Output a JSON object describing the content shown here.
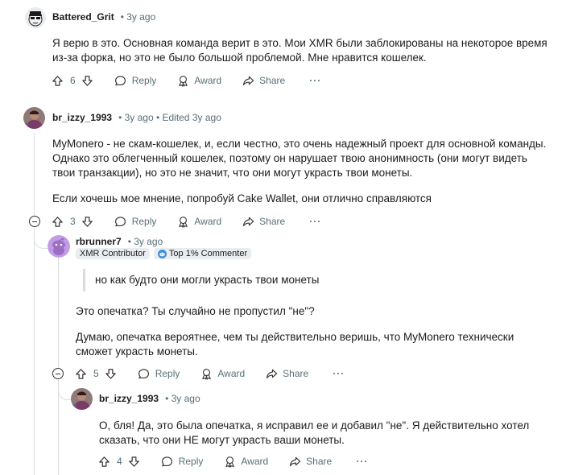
{
  "comments": [
    {
      "username": "Battered_Grit",
      "meta": "• 3y ago",
      "body": [
        "Я верю в это. Основная команда верит в это. Мои XMR были заблокированы на некоторое время из-за форка, но это не было большой проблемой. Мне нравится кошелек."
      ],
      "votes": "6"
    },
    {
      "username": "br_izzy_1993",
      "meta": "• 3y ago • Edited 3y ago",
      "body": [
        "MyMonero - не скам-кошелек, и, если честно, это очень надежный проект для основной команды. Однако это облегченный кошелек, поэтому он нарушает твою анонимность (они могут видеть твои транзакции), но это не значит, что они могут украсть твои монеты.",
        "Если хочешь мое мнение, попробуй Cake Wallet, они отлично справляются"
      ],
      "votes": "3"
    },
    {
      "username": "rbrunner7",
      "meta": "• 3y ago",
      "flair1": "XMR Contributor",
      "flair2": "Top 1% Commenter",
      "quote": "но как будто они могли украсть твои монеты",
      "body": [
        "Это опечатка? Ты случайно не пропустил \"не\"?",
        "Думаю, опечатка вероятнее, чем ты действительно веришь, что MyMonero технически сможет украсть монеты."
      ],
      "votes": "5"
    },
    {
      "username": "br_izzy_1993",
      "meta": "• 3y ago",
      "body": [
        "О, бля! Да, это была опечатка, я исправил ее и добавил \"не\". Я действительно хотел сказать, что они НЕ могут украсть ваши монеты."
      ],
      "votes": "4"
    }
  ],
  "actions": {
    "reply": "Reply",
    "award": "Award",
    "share": "Share",
    "more": "···"
  },
  "icons": {
    "upvote": "upvote-arrow-icon",
    "downvote": "downvote-arrow-icon",
    "reply": "speech-bubble-icon",
    "award": "award-ribbon-icon",
    "share": "share-arrow-icon",
    "collapse": "collapse-minus-icon",
    "flair": "snoo-flair-icon"
  },
  "colors": {
    "meta": "#576f76",
    "thread": "#d7dcdf",
    "badge_bg": "#eaedef",
    "avatar_reddit": "#c29be6"
  }
}
